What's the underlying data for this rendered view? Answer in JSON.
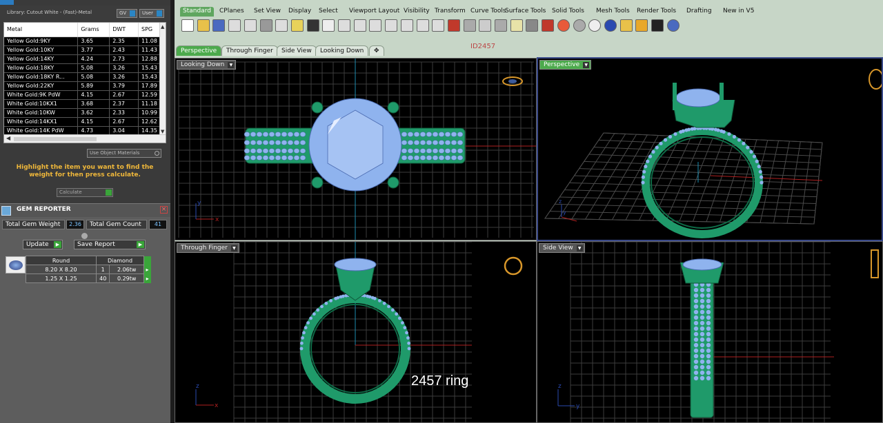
{
  "library": {
    "label": "Library: Cutout White - (Fast)-Metal",
    "gv_label": "GV",
    "user_label": "User"
  },
  "metal_table": {
    "headers": [
      "Metal",
      "Grams",
      "DWT",
      "SPG"
    ],
    "rows": [
      [
        "Yellow Gold:9KY",
        "3.65",
        "2.35",
        "11.08"
      ],
      [
        "Yellow Gold:10KY",
        "3.77",
        "2.43",
        "11.43"
      ],
      [
        "Yellow Gold:14KY",
        "4.24",
        "2.73",
        "12.88"
      ],
      [
        "Yellow Gold:18KY",
        "5.08",
        "3.26",
        "15.43"
      ],
      [
        "Yellow Gold:18KY R...",
        "5.08",
        "3.26",
        "15.43"
      ],
      [
        "Yellow Gold:22KY",
        "5.89",
        "3.79",
        "17.89"
      ],
      [
        "White Gold:9K PdW",
        "4.15",
        "2.67",
        "12.59"
      ],
      [
        "White Gold:10KX1",
        "3.68",
        "2.37",
        "11.18"
      ],
      [
        "White Gold:10KW",
        "3.62",
        "2.33",
        "10.99"
      ],
      [
        "White Gold:14KX1",
        "4.15",
        "2.67",
        "12.62"
      ],
      [
        "White Gold:14K PdW",
        "4.73",
        "3.04",
        "14.35"
      ]
    ]
  },
  "controls": {
    "use_object_materials": "Use Object Materials",
    "hint": "Highlight the item you want to find the weight for then press calculate.",
    "calculate": "Calculate"
  },
  "gem_reporter": {
    "title": "GEM REPORTER",
    "total_weight_label": "Total Gem Weight",
    "total_weight_value": "2.36",
    "total_count_label": "Total Gem Count",
    "total_count_value": "41",
    "update_label": "Update",
    "save_report_label": "Save Report",
    "table": {
      "headers": [
        "Round",
        "Diamond"
      ],
      "rows": [
        [
          "8.20 X 8.20",
          "1",
          "2.06tw"
        ],
        [
          "1.25 X 1.25",
          "40",
          "0.29tw"
        ]
      ]
    }
  },
  "toolbar_tabs": [
    "Standard",
    "CPlanes",
    "Set View",
    "Display",
    "Select",
    "Viewport Layout",
    "Visibility",
    "Transform",
    "Curve Tools",
    "Surface Tools",
    "Solid Tools",
    "Mesh Tools",
    "Render Tools",
    "Drafting",
    "New in V5"
  ],
  "toolbar_icons": [
    "new-file",
    "open-folder",
    "save",
    "print",
    "import",
    "cut",
    "copy",
    "paste",
    "undo",
    "pan",
    "move",
    "zoom-in",
    "zoom-window",
    "zoom-extents",
    "zoom-selected",
    "rotate-view",
    "four-viewports",
    "car",
    "shade",
    "grid",
    "points",
    "light",
    "lock",
    "layer",
    "color-wheel",
    "sphere-grey",
    "sphere-white",
    "sphere-blue",
    "filter",
    "gear",
    "dimension",
    "help"
  ],
  "viewport_tabs": [
    "Perspective",
    "Through Finger",
    "Side View",
    "Looking Down"
  ],
  "id_label": "ID2457",
  "viewports": {
    "looking_down": "Looking Down",
    "perspective": "Perspective",
    "through_finger": "Through Finger",
    "side_view": "Side View"
  },
  "caption": "2457 ring",
  "colors": {
    "ring_green": "#1f9a6a",
    "gem_blue": "#8fb3ee",
    "grid": "#7a7a7a",
    "accent_green": "#4caa4c"
  }
}
